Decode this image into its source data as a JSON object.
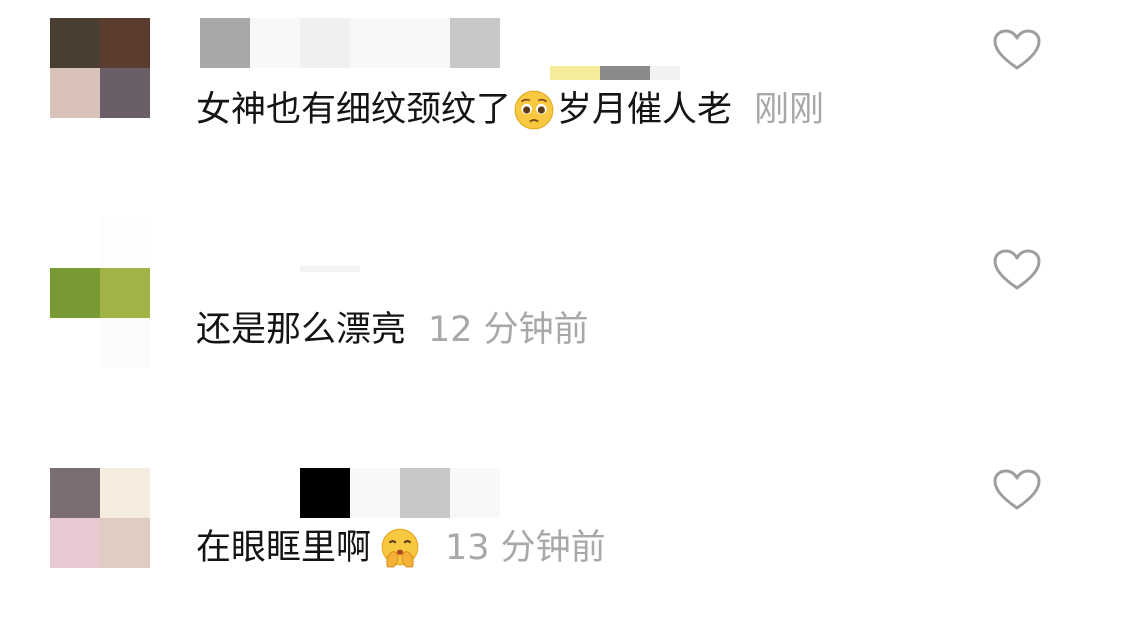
{
  "comments": [
    {
      "avatar_colors": [
        "#4a3e33",
        "#5a3d2e",
        "#d8c2ba",
        "#6a5e67"
      ],
      "username_colors": [
        "#a8a8a8",
        "#f8f8f8",
        "#f0f0f0",
        "#f8f8f8",
        "#f8f8f8",
        "#c8c8c8"
      ],
      "text": "女神也有细纹颈纹了",
      "emoji": "pleading-face",
      "text_after_emoji": "岁月催人老",
      "time": "刚刚"
    },
    {
      "avatar_colors": [
        "#789a34",
        "#a0b446",
        "#ffffff",
        "#fdfafd"
      ],
      "username_colors": [],
      "text": "还是那么漂亮",
      "emoji": "",
      "text_after_emoji": "",
      "time": "12 分钟前"
    },
    {
      "avatar_colors": [
        "#7a6e72",
        "#f6ede0",
        "#e7c9d1",
        "#dfccc2"
      ],
      "username_colors": [
        "#ffffff",
        "#ffffff",
        "#000000",
        "#f8f8f8",
        "#c8c8c8",
        "#f8f8f8"
      ],
      "text": "在眼眶里啊",
      "emoji": "shushing-face",
      "text_after_emoji": "",
      "time": "13 分钟前"
    }
  ],
  "like_icon": "heart-outline-icon",
  "icon_color": "#9e9e9e"
}
